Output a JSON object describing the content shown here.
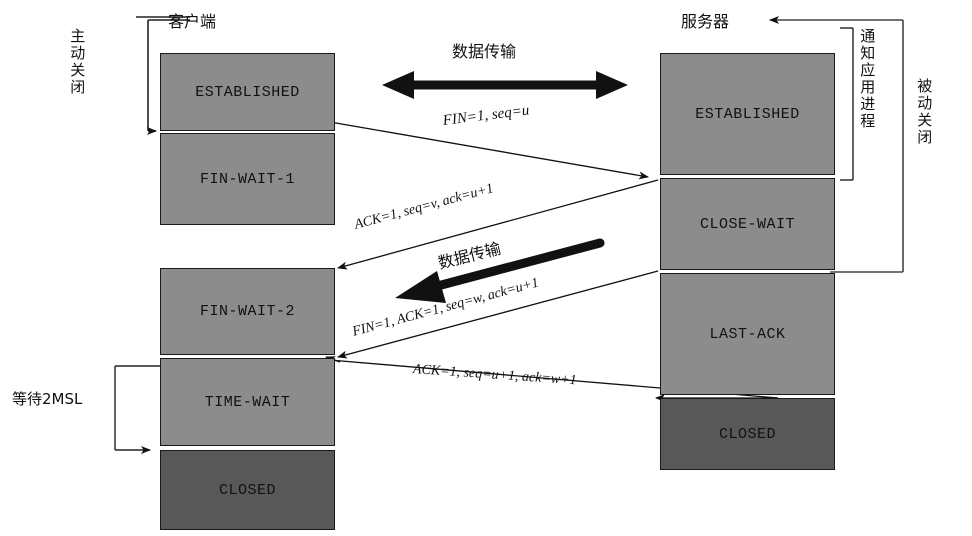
{
  "diagram": {
    "title_client": "客户端",
    "title_server": "服务器",
    "left_bracket_label": "主动关闭",
    "left_wait_label": "等待2MSL",
    "right_inner_label": "通知应用进程",
    "right_outer_label": "被动关闭",
    "colors": {
      "box_light": "#8c8c8c",
      "box_dark": "#585858",
      "stroke": "#1a1a1a",
      "background": "#ffffff"
    }
  },
  "client_states": [
    {
      "label": "ESTABLISHED",
      "shade": "light"
    },
    {
      "label": "FIN-WAIT-1",
      "shade": "light"
    },
    {
      "label": "FIN-WAIT-2",
      "shade": "light"
    },
    {
      "label": "TIME-WAIT",
      "shade": "light"
    },
    {
      "label": "CLOSED",
      "shade": "dark"
    }
  ],
  "server_states": [
    {
      "label": "ESTABLISHED",
      "shade": "light"
    },
    {
      "label": "CLOSE-WAIT",
      "shade": "light"
    },
    {
      "label": "LAST-ACK",
      "shade": "light"
    },
    {
      "label": "CLOSED",
      "shade": "dark"
    }
  ],
  "data_transfers": [
    {
      "label": "数据传输",
      "direction": "bidirectional"
    },
    {
      "label": "数据传输",
      "direction": "right-to-left"
    }
  ],
  "messages": [
    {
      "text": "FIN=1,  seq=u",
      "direction": "client-to-server"
    },
    {
      "text": "ACK=1, seq=v, ack=u+1",
      "direction": "server-to-client"
    },
    {
      "text": "FIN=1,  ACK=1,  seq=w, ack=u+1",
      "direction": "server-to-client"
    },
    {
      "text": "ACK=1, seq=u+1, ack=w+1",
      "direction": "client-to-server"
    }
  ]
}
